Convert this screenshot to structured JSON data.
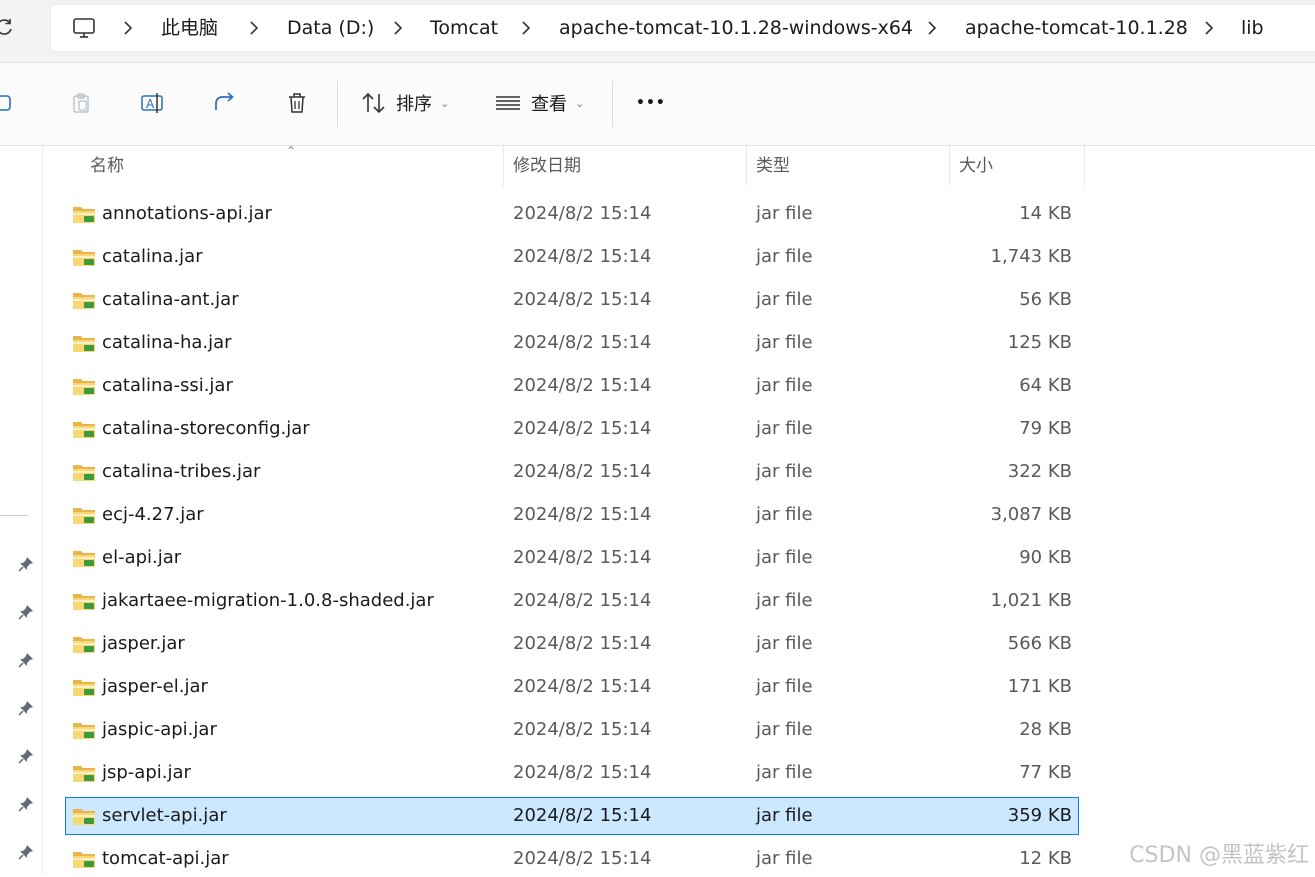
{
  "address_bar": {
    "breadcrumbs": [
      "此电脑",
      "Data (D:)",
      "Tomcat",
      "apache-tomcat-10.1.28-windows-x64",
      "apache-tomcat-10.1.28",
      "lib"
    ]
  },
  "toolbar": {
    "sort_label": "排序",
    "view_label": "查看",
    "more_label": "•••"
  },
  "columns": {
    "name": "名称",
    "modified": "修改日期",
    "type": "类型",
    "size": "大小"
  },
  "files": [
    {
      "name": "annotations-api.jar",
      "modified": "2024/8/2 15:14",
      "type": "jar file",
      "size": "14 KB"
    },
    {
      "name": "catalina.jar",
      "modified": "2024/8/2 15:14",
      "type": "jar file",
      "size": "1,743 KB"
    },
    {
      "name": "catalina-ant.jar",
      "modified": "2024/8/2 15:14",
      "type": "jar file",
      "size": "56 KB"
    },
    {
      "name": "catalina-ha.jar",
      "modified": "2024/8/2 15:14",
      "type": "jar file",
      "size": "125 KB"
    },
    {
      "name": "catalina-ssi.jar",
      "modified": "2024/8/2 15:14",
      "type": "jar file",
      "size": "64 KB"
    },
    {
      "name": "catalina-storeconfig.jar",
      "modified": "2024/8/2 15:14",
      "type": "jar file",
      "size": "79 KB"
    },
    {
      "name": "catalina-tribes.jar",
      "modified": "2024/8/2 15:14",
      "type": "jar file",
      "size": "322 KB"
    },
    {
      "name": "ecj-4.27.jar",
      "modified": "2024/8/2 15:14",
      "type": "jar file",
      "size": "3,087 KB"
    },
    {
      "name": "el-api.jar",
      "modified": "2024/8/2 15:14",
      "type": "jar file",
      "size": "90 KB"
    },
    {
      "name": "jakartaee-migration-1.0.8-shaded.jar",
      "modified": "2024/8/2 15:14",
      "type": "jar file",
      "size": "1,021 KB"
    },
    {
      "name": "jasper.jar",
      "modified": "2024/8/2 15:14",
      "type": "jar file",
      "size": "566 KB"
    },
    {
      "name": "jasper-el.jar",
      "modified": "2024/8/2 15:14",
      "type": "jar file",
      "size": "171 KB"
    },
    {
      "name": "jaspic-api.jar",
      "modified": "2024/8/2 15:14",
      "type": "jar file",
      "size": "28 KB"
    },
    {
      "name": "jsp-api.jar",
      "modified": "2024/8/2 15:14",
      "type": "jar file",
      "size": "77 KB"
    },
    {
      "name": "servlet-api.jar",
      "modified": "2024/8/2 15:14",
      "type": "jar file",
      "size": "359 KB",
      "selected": true
    },
    {
      "name": "tomcat-api.jar",
      "modified": "2024/8/2 15:14",
      "type": "jar file",
      "size": "12 KB"
    }
  ],
  "watermark": "CSDN @黑蓝紫红",
  "colors": {
    "selection_bg": "#cce8ff",
    "selection_border": "#0f7bd6",
    "folder_yellow": "#f5c85a",
    "jar_green": "#3c9a3c"
  }
}
